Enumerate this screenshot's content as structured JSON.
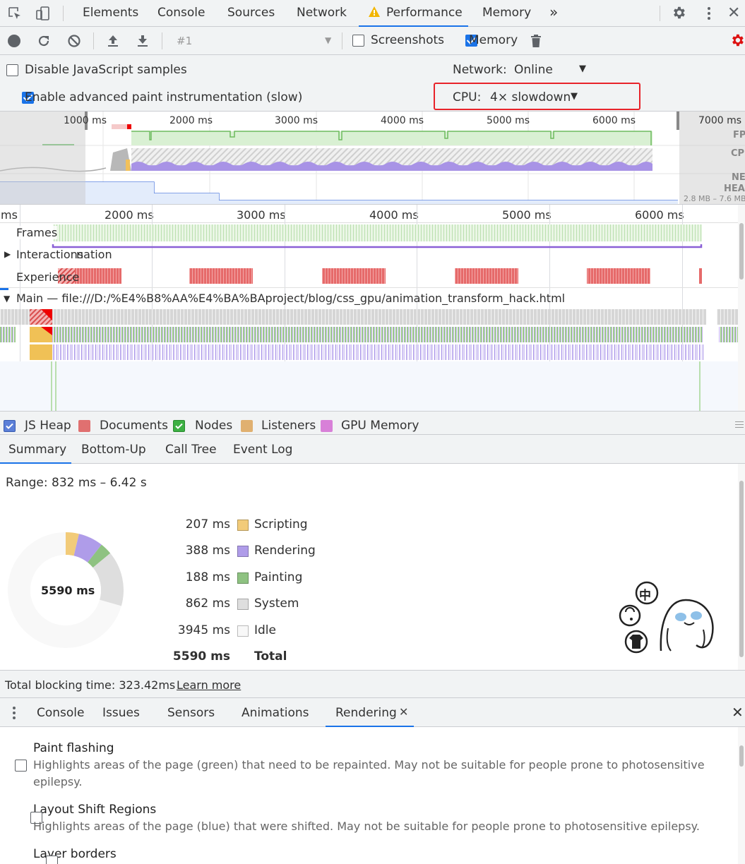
{
  "tabs": {
    "items": [
      "Elements",
      "Console",
      "Sources",
      "Network",
      "Performance",
      "Memory"
    ],
    "more": "»",
    "active_index": 4
  },
  "toolbar": {
    "profile_select": "#1",
    "screenshots_label": "Screenshots",
    "screenshots_checked": false,
    "memory_label": "Memory",
    "memory_checked": true
  },
  "settings": {
    "disable_js_samples": "Disable JavaScript samples",
    "disable_js_checked": false,
    "advanced_paint": "Enable advanced paint instrumentation (slow)",
    "advanced_paint_checked": true,
    "network_label": "Network:",
    "network_value": "Online",
    "cpu_label": "CPU:",
    "cpu_value": "4× slowdown"
  },
  "overview": {
    "ticks": [
      "1000 ms",
      "2000 ms",
      "3000 ms",
      "4000 ms",
      "5000 ms",
      "6000 ms",
      "7000 ms"
    ],
    "side_labels": [
      "FPS",
      "CPU",
      "NET",
      "HEAP"
    ],
    "heap_range": "2.8 MB – 7.6 MB"
  },
  "flame": {
    "ticks": [
      "ms",
      "2000 ms",
      "3000 ms",
      "4000 ms",
      "5000 ms",
      "6000 ms"
    ],
    "tracks": {
      "frames": "Frames",
      "interactions": "Interactions",
      "animation": "nation",
      "experience": "Experience",
      "main": "Main — file:///D:/%E4%B8%AA%E4%BA%BAproject/blog/css_gpu/animation_transform_hack.html"
    }
  },
  "memory_legend": [
    {
      "label": "JS Heap",
      "checked": true,
      "color": "#5b7fd8"
    },
    {
      "label": "Documents",
      "checked": false,
      "color": "#e07070"
    },
    {
      "label": "Nodes",
      "checked": true,
      "color": "#3cb043"
    },
    {
      "label": "Listeners",
      "checked": false,
      "color": "#e0b070"
    },
    {
      "label": "GPU Memory",
      "checked": false,
      "color": "#d880d8"
    }
  ],
  "details_tabs": [
    "Summary",
    "Bottom-Up",
    "Call Tree",
    "Event Log"
  ],
  "summary": {
    "range": "Range: 832 ms – 6.42 s",
    "total_center": "5590 ms",
    "rows": [
      {
        "value": "207 ms",
        "label": "Scripting",
        "color": "#f2cb79"
      },
      {
        "value": "388 ms",
        "label": "Rendering",
        "color": "#af9ce9"
      },
      {
        "value": "188 ms",
        "label": "Painting",
        "color": "#8ec281"
      },
      {
        "value": "862 ms",
        "label": "System",
        "color": "#dedede"
      },
      {
        "value": "3945 ms",
        "label": "Idle",
        "color": "#f8f8f8"
      }
    ],
    "total_value": "5590 ms",
    "total_label": "Total"
  },
  "footer": {
    "tbt": "Total blocking time: 323.42ms",
    "learn_more": "Learn more"
  },
  "drawer": {
    "tabs": [
      "Console",
      "Issues",
      "Sensors",
      "Animations",
      "Rendering"
    ],
    "active_index": 4,
    "items": [
      {
        "title": "Paint flashing",
        "desc": "Highlights areas of the page (green) that need to be repainted. May not be suitable for people prone to photosensitive epilepsy.",
        "checked": false
      },
      {
        "title": "Layout Shift Regions",
        "desc": "Highlights areas of the page (blue) that were shifted. May not be suitable for people prone to photosensitive epilepsy.",
        "checked": false
      },
      {
        "title": "Layer borders",
        "desc": "",
        "checked": false
      }
    ]
  },
  "sticker": {
    "badge": "中"
  }
}
